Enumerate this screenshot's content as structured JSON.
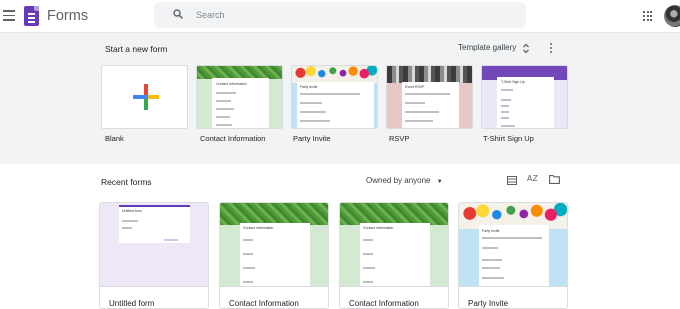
{
  "header": {
    "app_title": "Forms",
    "search_placeholder": "Search"
  },
  "templates": {
    "section_title": "Start a new form",
    "gallery_label": "Template gallery",
    "items": [
      {
        "label": "Blank",
        "icon": "plus-icon"
      },
      {
        "label": "Contact Information",
        "thumb_title": "Contact Information"
      },
      {
        "label": "Party Invite",
        "thumb_title": "Party Invite"
      },
      {
        "label": "RSVP",
        "thumb_title": "Event RSVP"
      },
      {
        "label": "T-Shirt Sign Up",
        "thumb_title": "T-Shirt Sign Up"
      }
    ]
  },
  "recent": {
    "section_title": "Recent forms",
    "owner_filter": "Owned by anyone",
    "sort_label": "AZ",
    "items": [
      {
        "title": "Untitled form",
        "thumb_title": "Untitled form"
      },
      {
        "title": "Contact Information",
        "thumb_title": "Contact information"
      },
      {
        "title": "Contact Information",
        "thumb_title": "Contact information"
      },
      {
        "title": "Party Invite",
        "thumb_title": "Party Invite"
      }
    ]
  },
  "colors": {
    "brand_purple": "#673ab7",
    "template_bg": "#f1f3f4",
    "green_theme": "#d4e9d1",
    "blue_theme": "#bfe3f5",
    "rsvp_theme": "#e8c7c7",
    "tshirt_theme": "#ece7f6"
  }
}
